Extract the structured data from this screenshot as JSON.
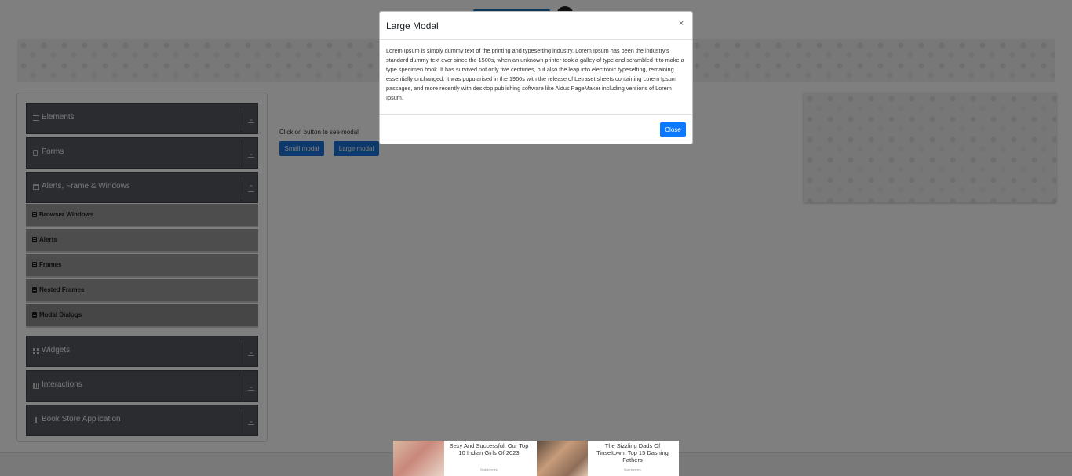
{
  "sidebar": {
    "groups": [
      {
        "label": "Elements",
        "icon": "list-icon",
        "arrow": "⤓"
      },
      {
        "label": "Forms",
        "icon": "document-icon",
        "arrow": "⤓"
      },
      {
        "label": "Alerts, Frame & Windows",
        "icon": "window-icon",
        "arrow": "⤒"
      },
      {
        "label": "Widgets",
        "icon": "grid-icon",
        "arrow": "⤓"
      },
      {
        "label": "Interactions",
        "icon": "interactions-icon",
        "arrow": "⤓"
      },
      {
        "label": "Book Store Application",
        "icon": "book-icon",
        "arrow": "⤓"
      }
    ],
    "subitems": [
      {
        "label": "Browser Windows"
      },
      {
        "label": "Alerts"
      },
      {
        "label": "Frames"
      },
      {
        "label": "Nested Frames"
      },
      {
        "label": "Modal Dialogs"
      }
    ]
  },
  "main": {
    "hint": "Click on button to see modal",
    "small_modal_label": "Small modal",
    "large_modal_label": "Large modal"
  },
  "modal": {
    "title": "Large Modal",
    "close_x": "×",
    "body": "Lorem Ipsum is simply dummy text of the printing and typesetting industry. Lorem Ipsum has been the industry's standard dummy text ever since the 1500s, when an unknown printer took a galley of type and scrambled it to make a type specimen book. It has survived not only five centuries, but also the leap into electronic typesetting, remaining essentially unchanged. It was popularised in the 1960s with the release of Letraset sheets containing Lorem Ipsum passages, and more recently with desktop publishing software like Aldus PageMaker including versions of Lorem Ipsum.",
    "close_label": "Close"
  },
  "ads": [
    {
      "title": "Sexy And Successful: Our Top 10 Indian Girls Of 2023",
      "source": "Brainberries"
    },
    {
      "title": "The Sizzling Dads Of Tinseltown: Top 15 Dashing Fathers",
      "source": "Brainberries"
    }
  ],
  "colors": {
    "primary_button": "#1a72d8",
    "close_button": "#0a78ff",
    "sidebar_group": "#545961",
    "sidebar_subitem": "#9a9a9a"
  }
}
